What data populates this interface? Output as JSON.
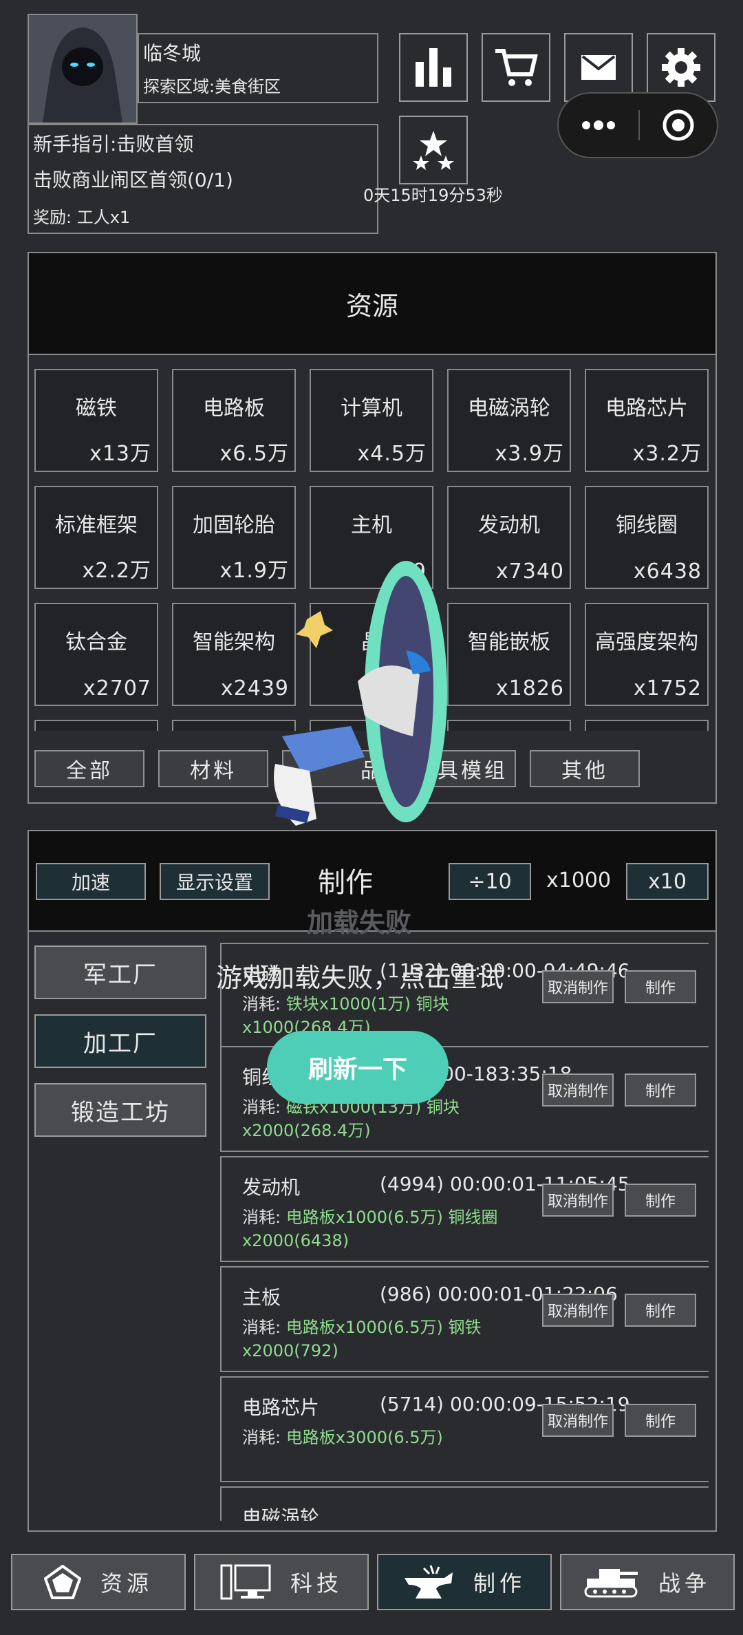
{
  "header": {
    "city": "临冬城",
    "region": "探索区域:美食街区",
    "quest_title": "新手指引:击败首领",
    "quest_task": "击败商业闹区首领(0/1)",
    "quest_reward": "奖励: 工人x1",
    "timer": "0天15时19分53秒"
  },
  "resources": {
    "title": "资源",
    "items": [
      {
        "name": "磁铁",
        "count": "x13万"
      },
      {
        "name": "电路板",
        "count": "x6.5万"
      },
      {
        "name": "计算机",
        "count": "x4.5万"
      },
      {
        "name": "电磁涡轮",
        "count": "x3.9万"
      },
      {
        "name": "电路芯片",
        "count": "x3.2万"
      },
      {
        "name": "标准框架",
        "count": "x2.2万"
      },
      {
        "name": "加固轮胎",
        "count": "x1.9万"
      },
      {
        "name": "主机",
        "count": "x9"
      },
      {
        "name": "发动机",
        "count": "x7340"
      },
      {
        "name": "铜线圈",
        "count": "x6438"
      },
      {
        "name": "钛合金",
        "count": "x2707"
      },
      {
        "name": "智能架构",
        "count": "x2439"
      },
      {
        "name": "晶",
        "count": ""
      },
      {
        "name": "智能嵌板",
        "count": "x1826"
      },
      {
        "name": "高强度架构",
        "count": "x1752"
      }
    ],
    "filters": [
      "全部",
      "材料",
      "品",
      "具模组",
      "其他"
    ]
  },
  "craft": {
    "title": "制作",
    "speed_label": "加速",
    "display_label": "显示设置",
    "div_label": "÷10",
    "amount": "x1000",
    "mul_label": "x10",
    "factories": [
      "军工厂",
      "加工厂",
      "锻造工坊"
    ],
    "cancel_label": "取消制作",
    "make_label": "制作",
    "items": [
      {
        "title": "电磁",
        "time": "(1132) 00:00:00-94:49:46",
        "cost_prefix": "消耗: ",
        "cost": "铁块x1000(1万) 铜块x1000(268.4万)"
      },
      {
        "title": "铜线",
        "time": "00:00:00-183:35:18",
        "cost_prefix": "消耗: ",
        "cost": "磁铁x1000(13万) 铜块x2000(268.4万)"
      },
      {
        "title": "发动机",
        "time": "(4994) 00:00:01-11:05:45",
        "cost_prefix": "消耗: ",
        "cost": "电路板x1000(6.5万) 铜线圈x2000(6438)"
      },
      {
        "title": "主板",
        "time": "(986) 00:00:01-01:22:06",
        "cost_prefix": "消耗: ",
        "cost": "电路板x1000(6.5万) 钢铁x2000(792)"
      },
      {
        "title": "电路芯片",
        "time": "(5714) 00:00:09-15:52:19",
        "cost_prefix": "消耗: ",
        "cost": "电路板x3000(6.5万)"
      },
      {
        "title": "电磁涡轮",
        "time": "",
        "cost_prefix": "",
        "cost": ""
      }
    ]
  },
  "overlay": {
    "title": "加载失败",
    "message": "游戏加载失败，点击重试",
    "button": "刷新一下"
  },
  "nav": [
    {
      "label": "资源"
    },
    {
      "label": "科技"
    },
    {
      "label": "制作"
    },
    {
      "label": "战争"
    }
  ]
}
